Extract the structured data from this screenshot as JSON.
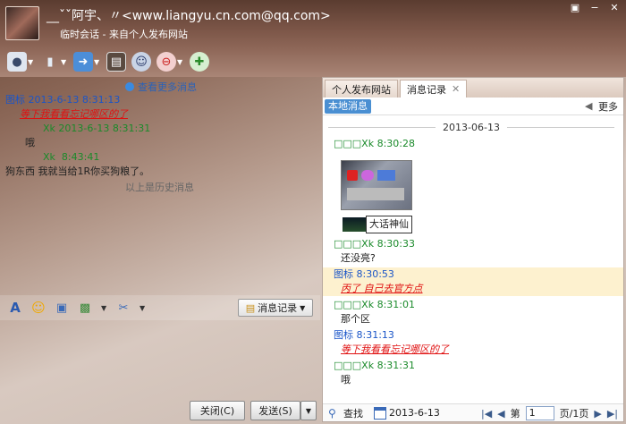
{
  "window": {
    "title": "__ˇˇ阿宇、〃<www.liangyu.cn.com@qq.com>",
    "subtitle": "临时会话 - 来自个人发布网站"
  },
  "toolbar": {
    "icons": [
      "camera-icon",
      "microphone-icon",
      "transfer-file-icon",
      "screenshot-icon",
      "user-icon",
      "block-user-icon",
      "add-user-icon"
    ]
  },
  "left_chat": {
    "more_messages": "查看更多消息",
    "messages": [
      {
        "sender": "图标",
        "time": "2013-6-13 8:31:13",
        "text": "等下我看看忘记哪区的了",
        "style": "red",
        "head_color": "blue"
      },
      {
        "sender": "Xk",
        "time": "2013-6-13 8:31:31",
        "text": "哦",
        "style": "dark",
        "head_color": "green"
      },
      {
        "sender": "Xk",
        "time": "8:43:41",
        "text": "狗东西 我就当给1R你买狗粮了。",
        "style": "dark",
        "head_color": "green"
      }
    ],
    "history_divider": "以上是历史消息",
    "message_record_button": "消息记录",
    "close_button": "关闭(C)",
    "send_button": "发送(S)"
  },
  "right_panel": {
    "tabs": [
      {
        "label": "个人发布网站",
        "active": false
      },
      {
        "label": "消息记录",
        "active": true
      }
    ],
    "local_messages": "本地消息",
    "more": "更多",
    "date": "2013-06-13",
    "messages": [
      {
        "head": "□□□Xk 8:30:28",
        "head_color": "green",
        "text": "",
        "style": "media"
      },
      {
        "head": "□□□Xk 8:30:33",
        "head_color": "green",
        "text": "还没亮?",
        "style": "dark"
      },
      {
        "head": "图标 8:30:53",
        "head_color": "blue",
        "text": "丙了 自己去官方点",
        "style": "red",
        "highlight": true
      },
      {
        "head": "□□□Xk 8:31:01",
        "head_color": "green",
        "text": "那个区",
        "style": "dark"
      },
      {
        "head": "图标 8:31:13",
        "head_color": "blue",
        "text": "等下我看看忘记哪区的了",
        "style": "red"
      },
      {
        "head": "□□□Xk 8:31:31",
        "head_color": "green",
        "text": "哦",
        "style": "dark"
      }
    ],
    "tooltip": "大话神仙",
    "find": "查找",
    "bottom_date": "2013-6-13",
    "page_label": "第",
    "page_value": "1",
    "page_total": "页/1页"
  }
}
